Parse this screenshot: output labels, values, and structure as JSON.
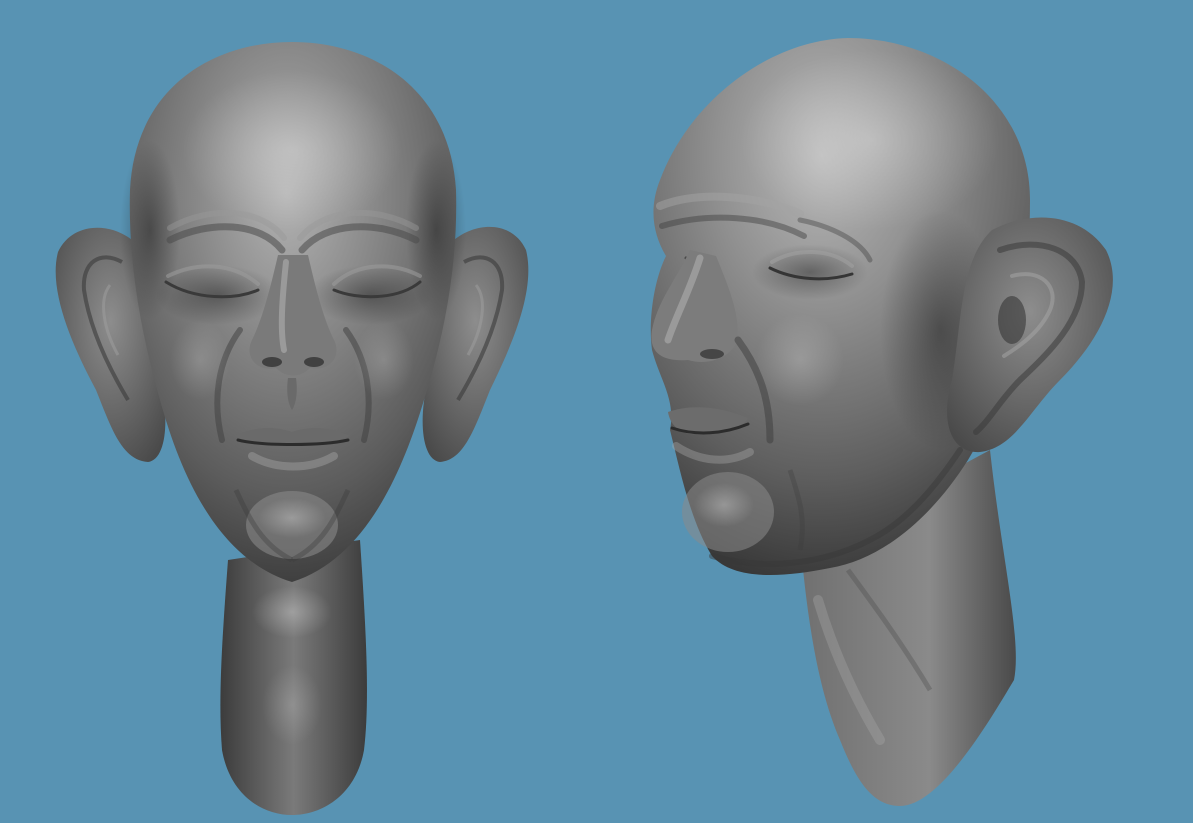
{
  "scene": {
    "background_color": "#5893b3",
    "clay_base_color": "#6b6b6b",
    "clay_highlight_color": "#a8a8a8",
    "clay_shadow_color": "#2e2e2e",
    "models": [
      {
        "name": "head-sculpt-front-view",
        "view": "front"
      },
      {
        "name": "head-sculpt-three-quarter-view",
        "view": "three-quarter"
      }
    ]
  }
}
